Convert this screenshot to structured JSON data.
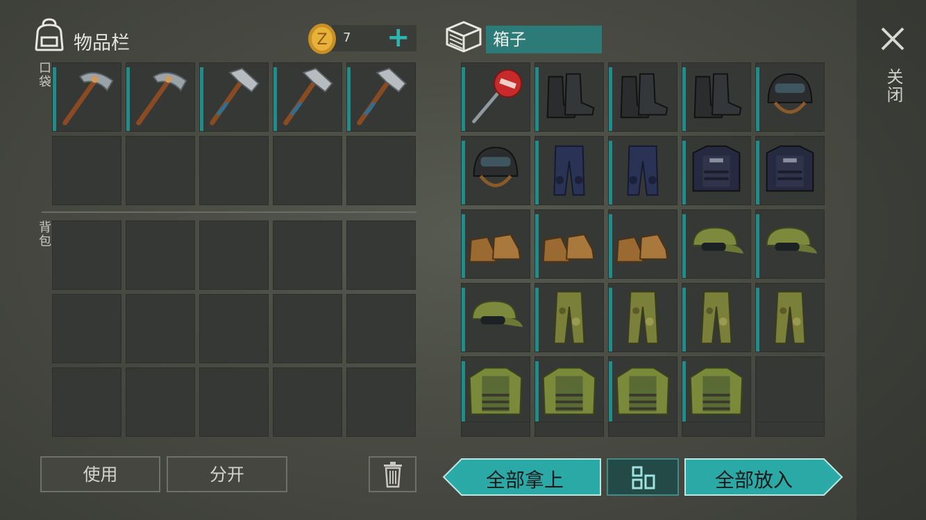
{
  "inventory": {
    "title": "物品栏",
    "coin_count": "7",
    "coin_plus": "+",
    "pocket_label": "口袋",
    "backpack_label": "背包",
    "pocket_items": [
      "pickaxe",
      "pickaxe",
      "hammer",
      "hammer",
      "hammer",
      "empty",
      "empty",
      "empty",
      "empty",
      "empty"
    ],
    "backpack_items": [
      "empty",
      "empty",
      "empty",
      "empty",
      "empty",
      "empty",
      "empty",
      "empty",
      "empty",
      "empty",
      "empty",
      "empty",
      "empty",
      "empty",
      "empty"
    ]
  },
  "box": {
    "title": "箱子",
    "items": [
      "stop-sign",
      "black-boots",
      "black-boots",
      "black-boots",
      "black-helmet",
      "black-helmet",
      "police-pants",
      "police-pants",
      "police-vest",
      "police-vest",
      "tan-boots",
      "tan-boots",
      "tan-boots",
      "camo-cap",
      "camo-cap",
      "camo-cap",
      "camo-pants",
      "camo-pants",
      "camo-pants",
      "camo-pants",
      "camo-jacket",
      "camo-jacket",
      "camo-jacket",
      "camo-jacket",
      "empty"
    ]
  },
  "close_label": "关闭",
  "buttons": {
    "use": "使用",
    "split": "分开",
    "take_all": "全部拿上",
    "put_all": "全部放入",
    "sort_icon": "grid-sort-icon",
    "trash_icon": "trash-icon"
  },
  "colors": {
    "accent": "#2fb5b0",
    "durability": "#1f8d8b",
    "teal_button": "#2aa9a6"
  }
}
